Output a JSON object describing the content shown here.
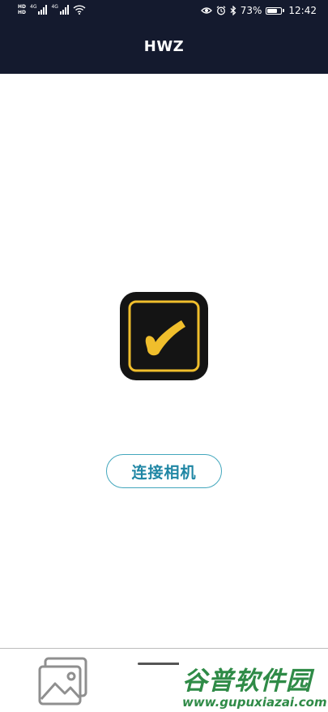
{
  "status_bar": {
    "hd1": "HD",
    "hd2": "HD",
    "net1": "4G",
    "net2": "4G",
    "battery_percent": "73%",
    "battery_level": 0.73,
    "time": "12:42",
    "icons": [
      "eye-icon",
      "alarm-icon",
      "bluetooth-icon",
      "battery-icon",
      "wifi-icon"
    ]
  },
  "header": {
    "title": "HWZ"
  },
  "main": {
    "logo_icon": "checkmark-icon",
    "connect_label": "连接相机"
  },
  "bottom_nav": {
    "gallery_icon": "gallery-icon"
  },
  "watermark": {
    "title": "谷普软件园",
    "url": "www.gupuxiazai.com"
  },
  "colors": {
    "header_bg": "#141a2e",
    "accent": "#1f86a4",
    "logo_yellow": "#f0be2c",
    "watermark": "#2f8b47"
  }
}
